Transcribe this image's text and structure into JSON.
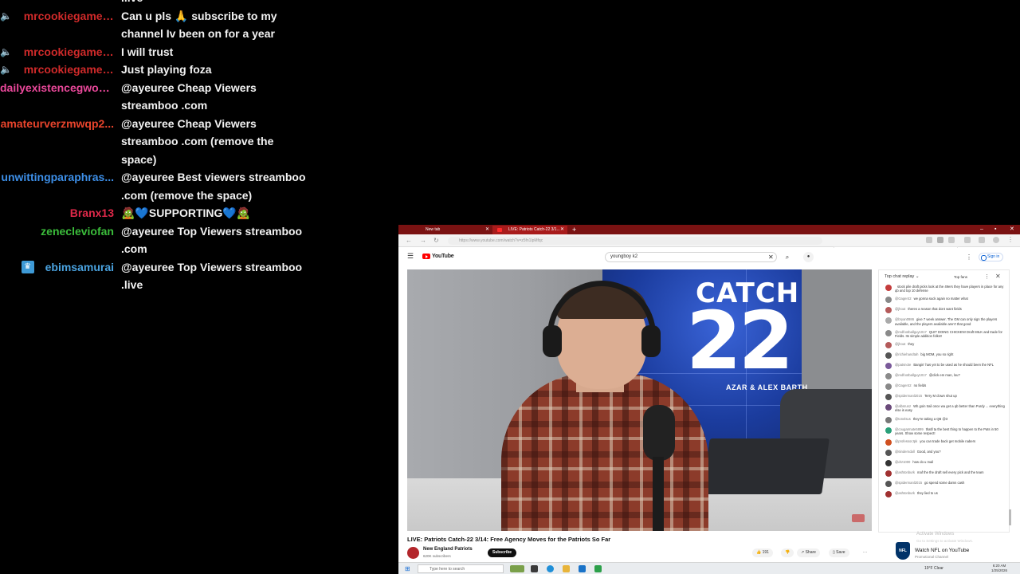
{
  "overlay_chat": {
    "messages": [
      {
        "user": "",
        "user_color": "#ff5555",
        "badge": "",
        "text": ".live"
      },
      {
        "user": "mrcookiegamer...",
        "user_color": "#d02a2a",
        "badge": "speaker",
        "text": "Can u pls 🙏 subscribe to my channel Iv been on for a year"
      },
      {
        "user": "mrcookiegamer...",
        "user_color": "#d02a2a",
        "badge": "speaker",
        "text": "I will trust"
      },
      {
        "user": "mrcookiegamer...",
        "user_color": "#d02a2a",
        "badge": "speaker",
        "text": "Just playing foza"
      },
      {
        "user": "dailyexistencegwo5...",
        "user_color": "#e9489a",
        "badge": "",
        "text": "@ayeuree Cheap Viewers streamboo .com"
      },
      {
        "user": "amateurverzmwqp2...",
        "user_color": "#e8442c",
        "badge": "",
        "text": "@ayeuree Cheap Viewers streamboo .com (remove the space)"
      },
      {
        "user": "unwittingparaphras...",
        "user_color": "#3d8fe8",
        "badge": "",
        "text": "@ayeuree Best viewers streamboo .com (remove the space)"
      },
      {
        "user": "Branx13",
        "user_color": "#e0294a",
        "badge": "",
        "text": "🧟💙SUPPORTING💙🧟"
      },
      {
        "user": "zenecleviofan",
        "user_color": "#3bbd3b",
        "badge": "",
        "text": "@ayeuree Top Viewers streamboo .com"
      },
      {
        "user": "ebimsamurai",
        "user_color": "#4aa3e0",
        "badge": "crown",
        "text": "@ayeuree Top Viewers streamboo .live"
      }
    ]
  },
  "browser": {
    "tabs": [
      {
        "label": "New tab"
      },
      {
        "label": "LIVE: Patriots Catch-22 3/1..."
      }
    ],
    "url": "https://www.youtube.com/watch?v=z5fn1lpMfqc",
    "colors": {
      "tabbar": "#7a1212",
      "accent": "#ff0000"
    }
  },
  "youtube": {
    "logo_text": "YouTube",
    "search_value": "youngboy k2",
    "sign_in": "Sign in",
    "video": {
      "overlay_title": "CATCH",
      "overlay_number": "22",
      "overlay_hosts": "AZAR & ALEX BARTH",
      "title": "LIVE: Patriots Catch-22 3/14: Free Agency Moves for the Patriots So Far",
      "channel": "New England Patriots",
      "subscribers": "620K subscribers",
      "subscribe": "Subscribe",
      "likes": "191",
      "share": "Share",
      "save": "Save",
      "more": "···"
    },
    "live_chat": {
      "title": "Top chat replay",
      "pill": "Top fans",
      "messages": [
        {
          "user": "",
          "text": "stock pile draft picks look at the 49ers they have players in place for any qb and top 10 defense",
          "color": "#c43c3c"
        },
        {
          "user": "@Gager42",
          "text": "we gonna suck again no matter what",
          "color": "#888888"
        },
        {
          "user": "@jhout",
          "text": "theres a reason that dont want fields",
          "color": "#b45a5a"
        },
        {
          "user": "@bryan0986",
          "text": "give 7 week answer. The GM can only sign the players available, and the players available aren't that good",
          "color": "#aaaaaa"
        },
        {
          "user": "@redfootballguy1017",
          "text": "QUIT DOING CHICKEN! Draft MILK and trade for Fields. Its simple addition folks!!",
          "color": "#8a8a8a"
        },
        {
          "user": "@jhout",
          "text": "they",
          "color": "#b45a5a"
        },
        {
          "user": "@richiehandtah",
          "text": "big MOM, you so right",
          "color": "#555555"
        },
        {
          "user": "@patsnote",
          "text": "Bangin' has yet to be used as he should been the NFL",
          "color": "#7a5a9a"
        },
        {
          "user": "@redfootballguy1017",
          "text": "@click em man, lou?",
          "color": "#8a8a8a"
        },
        {
          "user": "@Gager42",
          "text": "no fields",
          "color": "#888888"
        },
        {
          "user": "@spidermanl2015",
          "text": "Terry M clown shut up",
          "color": "#555555"
        },
        {
          "user": "@albsrunz",
          "text": "Wh goin trail once wa get a qb better than Purdy ... everything else is easy",
          "color": "#6a4a7a"
        },
        {
          "user": "@tonelsus",
          "text": "they're taking a QB @3",
          "color": "#777777"
        },
        {
          "user": "@cougarmate5899",
          "text": "thatll ta the best thing to happen to the Pats in 50 years. Show some respect!",
          "color": "#2aa07a"
        },
        {
          "user": "@professorJpk",
          "text": "you can trade back get mobile nabers",
          "color": "#d05020"
        },
        {
          "user": "@6inderndall",
          "text": "Good, and you?",
          "color": "#555555"
        },
        {
          "user": "@drz1000",
          "text": "how do u mail",
          "color": "#333333"
        },
        {
          "user": "@ashtonburk",
          "text": "maf the the draft sell every pick and the team",
          "color": "#a03030"
        },
        {
          "user": "@spidermanl2015",
          "text": "go spend some damn cash",
          "color": "#555555"
        },
        {
          "user": "@ashtonburk",
          "text": "they lied to us",
          "color": "#a03030"
        }
      ]
    },
    "watermark": {
      "line1": "Activate Windows",
      "line2": "Go to Settings to activate Windows."
    },
    "nfl_channel": {
      "badge": "NFL",
      "title": "Watch NFL on YouTube",
      "subtitle": "Promotional Channel"
    }
  },
  "taskbar": {
    "search_placeholder": "Type here to search",
    "weather": "19°F  Clear",
    "time": "6:20 AM",
    "date": "1/25/2026"
  }
}
